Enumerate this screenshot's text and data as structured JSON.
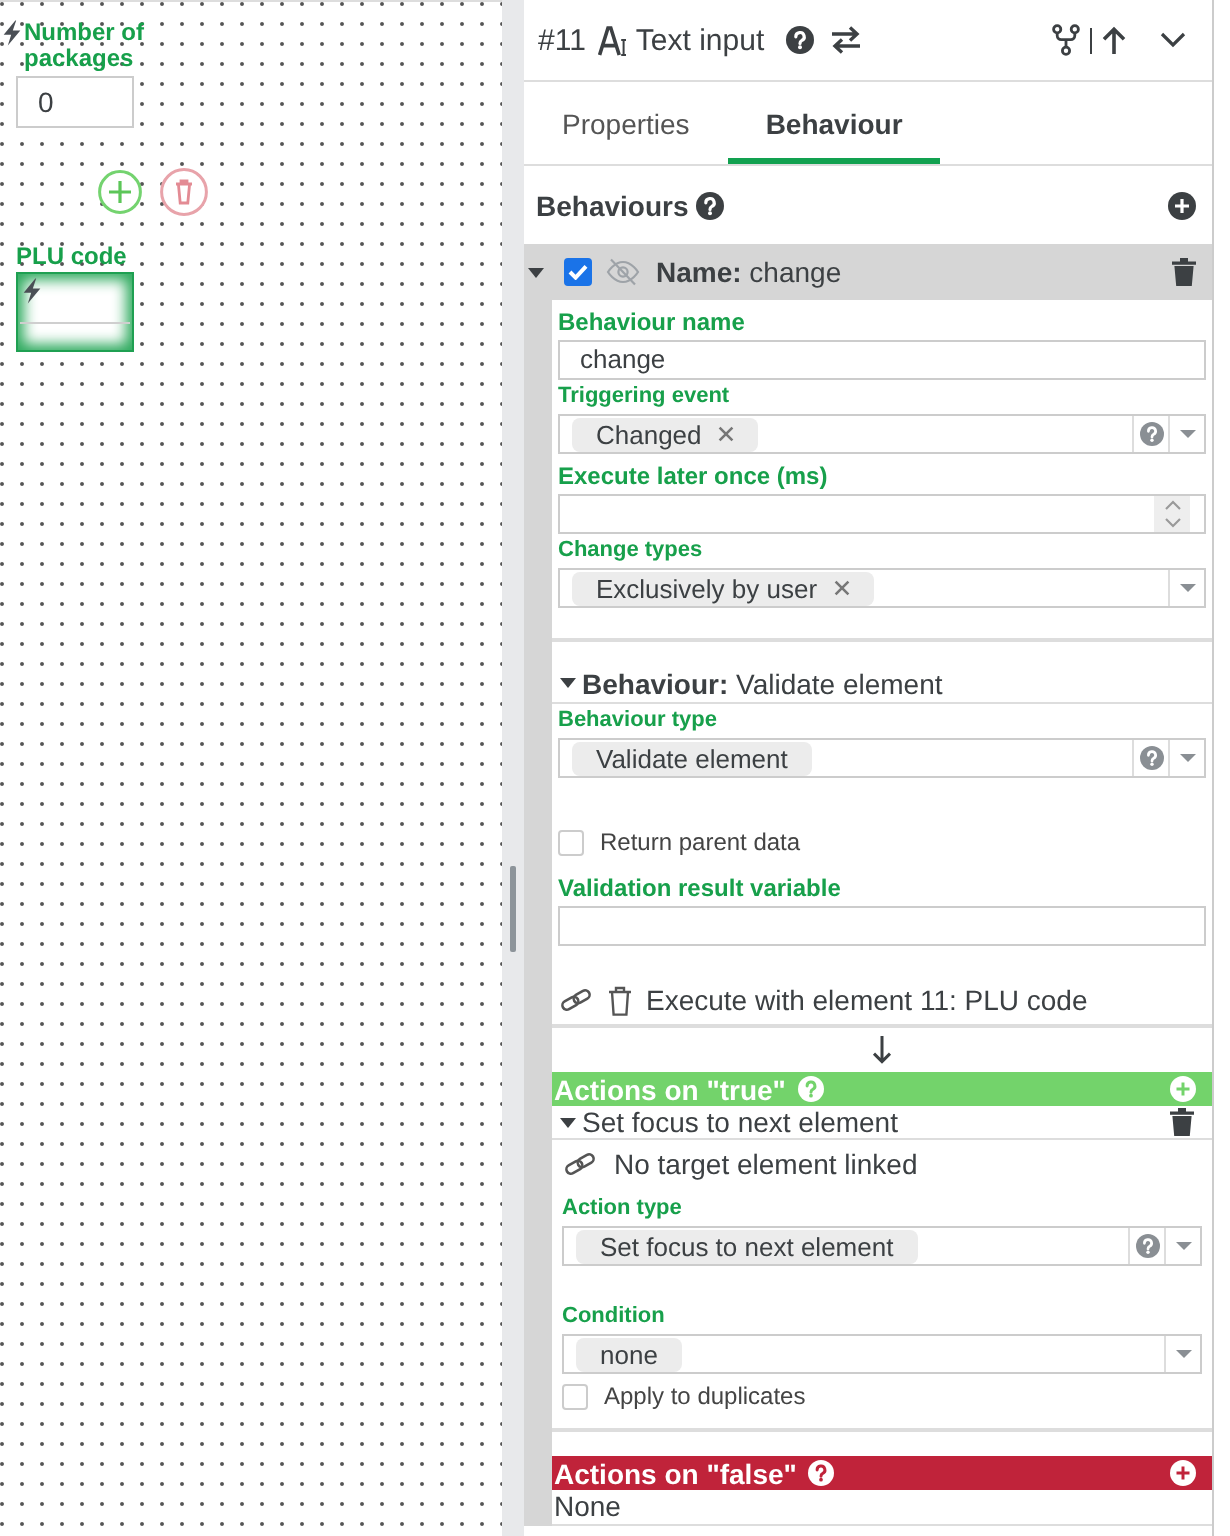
{
  "canvas": {
    "elements": [
      {
        "label": "Number of packages",
        "value": "0",
        "has_behaviour": true,
        "selected": false
      },
      {
        "label": "PLU code",
        "has_behaviour": true,
        "selected": true
      }
    ]
  },
  "header": {
    "number": "#11",
    "type": "Text input"
  },
  "tabs": [
    {
      "label": "Properties",
      "selected": false
    },
    {
      "label": "Behaviour",
      "selected": true
    }
  ],
  "behaviours": {
    "title": "Behaviours",
    "items": [
      {
        "enabled": true,
        "expanded": true,
        "title": "**Name:** change",
        "fields": [
          {
            "kind": "text",
            "label": "Behaviour name",
            "value": "change"
          },
          {
            "kind": "select",
            "label": "Triggering event",
            "chips": [
              {
                "label": "Changed",
                "removable": true
              }
            ],
            "help": true
          },
          {
            "kind": "number",
            "label": "Execute later once (ms)"
          },
          {
            "kind": "select",
            "label": "Change types",
            "chips": [
              {
                "label": "Exclusively by user",
                "removable": true
              }
            ],
            "help": false
          }
        ],
        "behaviour": {
          "expanded": true,
          "title": "**Behaviour:** Validate element",
          "fields": [
            {
              "kind": "select",
              "label": "Behaviour type",
              "chips": [
                {
                  "label": "Validate element",
                  "removable": false
                }
              ],
              "help": true
            },
            {
              "kind": "checkbox",
              "label": "Return parent data",
              "checked": false
            },
            {
              "kind": "text",
              "label": "Validation result variable"
            }
          ],
          "target": "Execute with element 11: PLU code"
        },
        "action_groups": [
          {
            "title": "Actions on \"true\"",
            "color": "#73d36b",
            "actions": [
              {
                "expanded": true,
                "title": "Set focus to next element",
                "target": "No target element linked",
                "fields": [
                  {
                    "kind": "select",
                    "label": "Action type",
                    "chips": [
                      {
                        "label": "Set focus to next element",
                        "removable": false
                      }
                    ],
                    "help": true
                  },
                  {
                    "kind": "select",
                    "label": "Condition",
                    "chips": [
                      {
                        "label": "none",
                        "removable": false
                      }
                    ],
                    "help": false
                  },
                  {
                    "kind": "checkbox",
                    "label": "Apply to duplicates",
                    "checked": false
                  }
                ]
              }
            ]
          },
          {
            "title": "Actions on \"false\"",
            "color": "#c0233a",
            "empty_text": "None"
          }
        ]
      }
    ]
  }
}
